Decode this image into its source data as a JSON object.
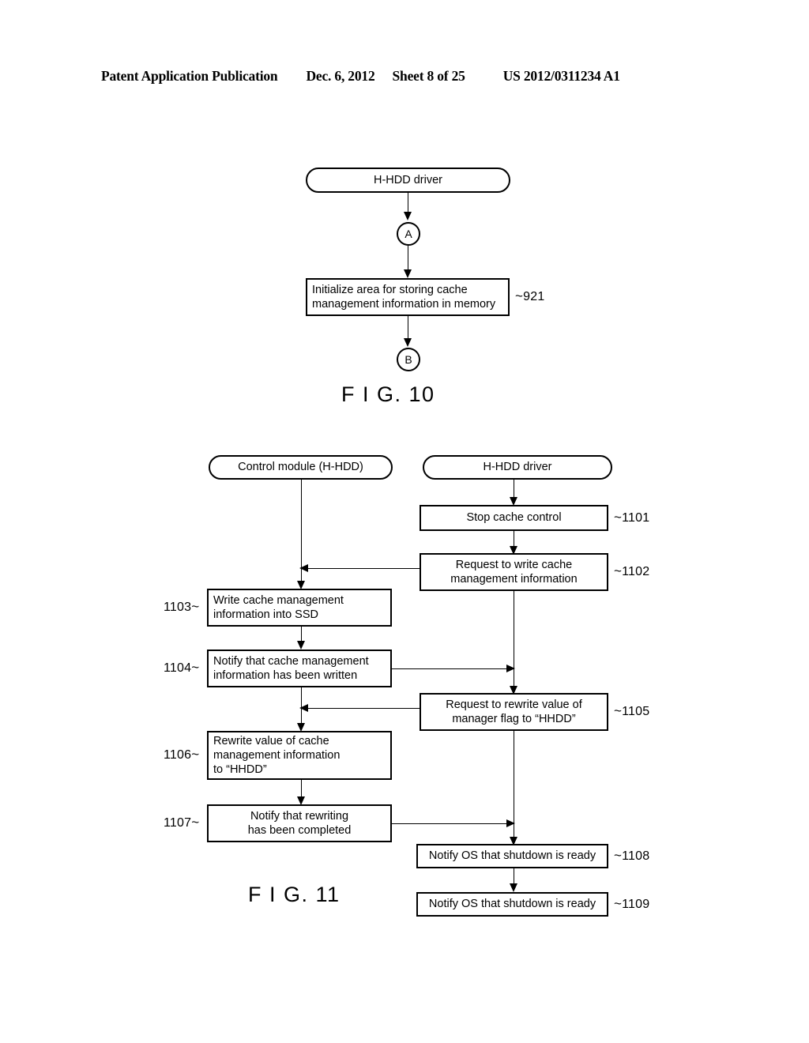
{
  "header": {
    "publication": "Patent Application Publication",
    "date": "Dec. 6, 2012",
    "sheet": "Sheet 8 of 25",
    "patent_number": "US 2012/0311234 A1"
  },
  "figures": [
    {
      "caption": "F I G. 10",
      "nodes": {
        "start_terminator": "H-HDD driver",
        "connector_a": "A",
        "step_921": {
          "line1": "Initialize area for storing cache",
          "line2": "management information in memory",
          "ref": "921",
          "tilde": "~"
        },
        "connector_b": "B"
      }
    },
    {
      "caption": "F I G. 11",
      "lanes": {
        "left_terminator": "Control module (H-HDD)",
        "right_terminator": "H-HDD driver"
      },
      "nodes": {
        "step_1101": {
          "line1": "Stop cache control",
          "ref": "1101",
          "tilde": "~"
        },
        "step_1102": {
          "line1": "Request to write cache",
          "line2": "management information",
          "ref": "1102",
          "tilde": "~"
        },
        "step_1103": {
          "line1": "Write cache management",
          "line2": "information into SSD",
          "ref": "1103",
          "tilde": "~"
        },
        "step_1104": {
          "line1": "Notify that cache management",
          "line2": "information has been written",
          "ref": "1104",
          "tilde": "~"
        },
        "step_1105": {
          "line1": "Request to rewrite value of",
          "line2": "manager flag to “HHDD”",
          "ref": "1105",
          "tilde": "~"
        },
        "step_1106": {
          "line1": "Rewrite value of cache",
          "line2": "management information",
          "line3": "to “HHDD”",
          "ref": "1106",
          "tilde": "~"
        },
        "step_1107": {
          "line1": "Notify that rewriting",
          "line2": "has been completed",
          "ref": "1107",
          "tilde": "~"
        },
        "step_1108": {
          "line1": "Notify OS that shutdown is ready",
          "ref": "1108",
          "tilde": "~"
        },
        "step_1109": {
          "line1": "Notify OS that shutdown is ready",
          "ref": "1109",
          "tilde": "~"
        }
      }
    }
  ]
}
